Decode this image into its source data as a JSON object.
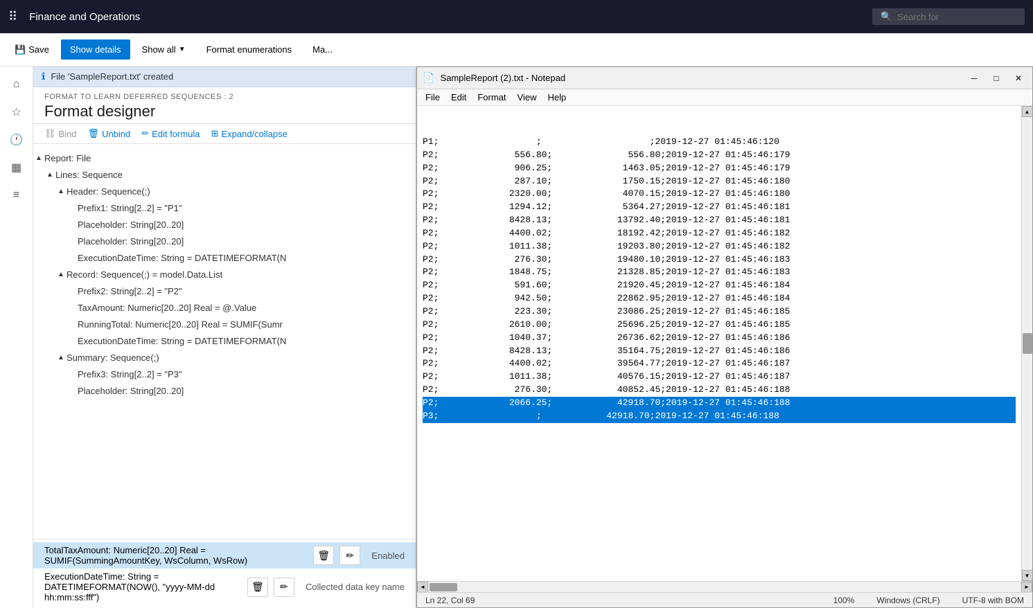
{
  "topnav": {
    "app_title": "Finance and Operations",
    "search_placeholder": "Search for"
  },
  "toolbar": {
    "save_label": "Save",
    "show_details_label": "Show details",
    "show_all_label": "Show all",
    "format_enumerations_label": "Format enumerations",
    "map_label": "Ma..."
  },
  "notification": {
    "message": "File 'SampleReport.txt' created"
  },
  "panel": {
    "subtitle": "FORMAT TO LEARN DEFERRED SEQUENCES : 2",
    "title": "Format designer"
  },
  "actions": {
    "bind_label": "Bind",
    "unbind_label": "Unbind",
    "edit_formula_label": "Edit formula",
    "expand_collapse_label": "Expand/collapse"
  },
  "tree": {
    "items": [
      {
        "id": "report-file",
        "text": "Report: File",
        "level": 0,
        "arrow": "▲",
        "selected": false
      },
      {
        "id": "lines-sequence",
        "text": "Lines: Sequence",
        "level": 1,
        "arrow": "▲",
        "selected": false
      },
      {
        "id": "header-sequence",
        "text": "Header: Sequence(;)",
        "level": 2,
        "arrow": "▲",
        "selected": false
      },
      {
        "id": "prefix1",
        "text": "Prefix1: String[2..2] = \"P1\"",
        "level": 3,
        "arrow": "",
        "selected": false
      },
      {
        "id": "placeholder1",
        "text": "Placeholder: String[20..20]",
        "level": 3,
        "arrow": "",
        "selected": false
      },
      {
        "id": "placeholder2",
        "text": "Placeholder: String[20..20]",
        "level": 3,
        "arrow": "",
        "selected": false
      },
      {
        "id": "executiondatetime1",
        "text": "ExecutionDateTime: String = DATETIMEFORMAT(N",
        "level": 3,
        "arrow": "",
        "selected": false
      },
      {
        "id": "record-sequence",
        "text": "Record: Sequence(;) = model.Data.List",
        "level": 2,
        "arrow": "▲",
        "selected": false
      },
      {
        "id": "prefix2",
        "text": "Prefix2: String[2..2] = \"P2\"",
        "level": 3,
        "arrow": "",
        "selected": false
      },
      {
        "id": "taxamount",
        "text": "TaxAmount: Numeric[20..20] Real = @.Value",
        "level": 3,
        "arrow": "",
        "selected": false
      },
      {
        "id": "runningtotal",
        "text": "RunningTotal: Numeric[20..20] Real = SUMIF(Sumr",
        "level": 3,
        "arrow": "",
        "selected": false
      },
      {
        "id": "executiondatetime2",
        "text": "ExecutionDateTime: String = DATETIMEFORMAT(N",
        "level": 3,
        "arrow": "",
        "selected": false
      },
      {
        "id": "summary-sequence",
        "text": "Summary: Sequence(;)",
        "level": 2,
        "arrow": "▲",
        "selected": false
      },
      {
        "id": "prefix3",
        "text": "Prefix3: String[2..2] = \"P3\"",
        "level": 3,
        "arrow": "",
        "selected": false
      },
      {
        "id": "placeholder3",
        "text": "Placeholder: String[20..20]",
        "level": 3,
        "arrow": "",
        "selected": false
      }
    ]
  },
  "bottom_props": [
    {
      "id": "totaltaxamount",
      "text": "TotalTaxAmount: Numeric[20..20] Real = SUMIF(SummingAmountKey, WsColumn, WsRow)",
      "selected": true,
      "action1": "🗑",
      "action2": "✏",
      "prop_label": "Enabled"
    },
    {
      "id": "executiondatetime3",
      "text": "ExecutionDateTime: String = DATETIMEFORMAT(NOW(), \"yyyy-MM-dd hh:mm:ss:fff\")",
      "selected": false,
      "action1": "🗑",
      "action2": "✏",
      "prop_label": "Collected data key name"
    }
  ],
  "notepad": {
    "title": "SampleReport (2).txt - Notepad",
    "menu_items": [
      "File",
      "Edit",
      "Format",
      "View",
      "Help"
    ],
    "lines": [
      {
        "text": "P1;                  ;                    ;2019-12-27 01:45:46:120",
        "highlighted": false
      },
      {
        "text": "P2;              556.80;              556.80;2019-12-27 01:45:46:179",
        "highlighted": false
      },
      {
        "text": "P2;              906.25;             1463.05;2019-12-27 01:45:46:179",
        "highlighted": false
      },
      {
        "text": "P2;              287.10;             1750.15;2019-12-27 01:45:46:180",
        "highlighted": false
      },
      {
        "text": "P2;             2320.00;             4070.15;2019-12-27 01:45:46:180",
        "highlighted": false
      },
      {
        "text": "P2;             1294.12;             5364.27;2019-12-27 01:45:46:181",
        "highlighted": false
      },
      {
        "text": "P2;             8428.13;            13792.40;2019-12-27 01:45:46:181",
        "highlighted": false
      },
      {
        "text": "P2;             4400.02;            18192.42;2019-12-27 01:45:46:182",
        "highlighted": false
      },
      {
        "text": "P2;             1011.38;            19203.80;2019-12-27 01:45:46:182",
        "highlighted": false
      },
      {
        "text": "P2;              276.30;            19480.10;2019-12-27 01:45:46:183",
        "highlighted": false
      },
      {
        "text": "P2;             1848.75;            21328.85;2019-12-27 01:45:46:183",
        "highlighted": false
      },
      {
        "text": "P2;              591.60;            21920.45;2019-12-27 01:45:46:184",
        "highlighted": false
      },
      {
        "text": "P2;              942.50;            22862.95;2019-12-27 01:45:46:184",
        "highlighted": false
      },
      {
        "text": "P2;              223.30;            23086.25;2019-12-27 01:45:46:185",
        "highlighted": false
      },
      {
        "text": "P2;             2610.00;            25696.25;2019-12-27 01:45:46:185",
        "highlighted": false
      },
      {
        "text": "P2;             1040.37;            26736.62;2019-12-27 01:45:46:186",
        "highlighted": false
      },
      {
        "text": "P2;             8428.13;            35164.75;2019-12-27 01:45:46:186",
        "highlighted": false
      },
      {
        "text": "P2;             4400.02;            39564.77;2019-12-27 01:45:46:187",
        "highlighted": false
      },
      {
        "text": "P2;             1011.38;            40576.15;2019-12-27 01:45:46:187",
        "highlighted": false
      },
      {
        "text": "P2;              276.30;            40852.45;2019-12-27 01:45:46:188",
        "highlighted": false
      },
      {
        "text": "P2;             2066.25;            42918.70;2019-12-27 01:45:46:188",
        "highlighted": true
      },
      {
        "text": "P3;                  ;            42918.70;2019-12-27 01:45:46:188",
        "highlighted": true
      }
    ],
    "statusbar": {
      "position": "Ln 22, Col 69",
      "zoom": "100%",
      "line_endings": "Windows (CRLF)",
      "encoding": "UTF-8 with BOM"
    }
  },
  "icons": {
    "waffle": "⋮⋮⋮",
    "search": "🔍",
    "home": "⌂",
    "star": "★",
    "recent": "🕐",
    "grid": "▦",
    "list": "≡",
    "filter": "⊿",
    "info": "ℹ",
    "minimize": "─",
    "maximize": "□",
    "close": "✕",
    "delete": "🗑",
    "edit": "✏"
  }
}
